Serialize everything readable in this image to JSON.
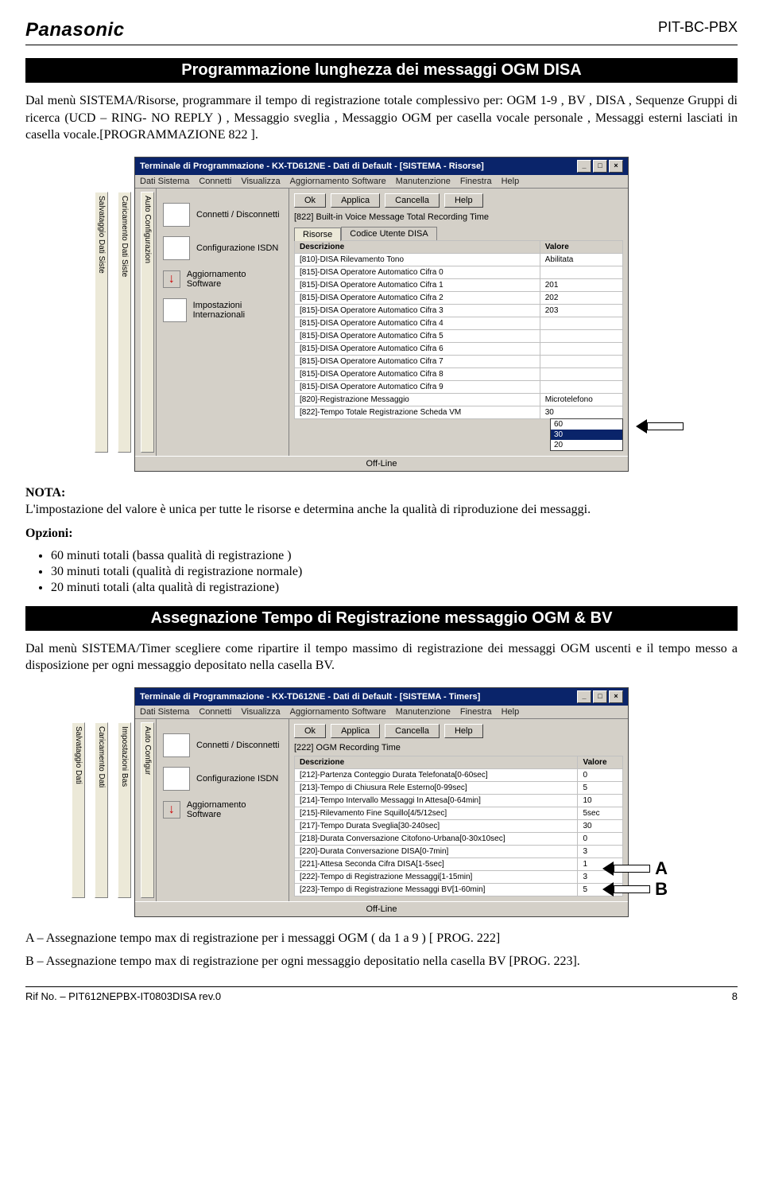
{
  "header": {
    "brand": "Panasonic",
    "code": "PIT-BC-PBX"
  },
  "section1": {
    "title": "Programmazione lunghezza dei messaggi OGM DISA",
    "intro": "Dal menù SISTEMA/Risorse, programmare il tempo di registrazione totale complessivo per: OGM 1-9 , BV , DISA , Sequenze Gruppi di ricerca (UCD – RING- NO REPLY ) , Messaggio sveglia , Messaggio OGM per casella vocale personale , Messaggi esterni lasciati in casella vocale.[PROGRAMMAZIONE 822 ].",
    "nota_label": "NOTA:",
    "nota_text": "L'impostazione del valore è unica per tutte le risorse e determina anche la qualità di riproduzione dei messaggi.",
    "opzioni_label": "Opzioni:",
    "opzioni": [
      "60 minuti totali (bassa qualità di registrazione )",
      "30 minuti totali (qualità di registrazione normale)",
      "20 minuti totali (alta qualità di registrazione)"
    ]
  },
  "section2": {
    "title": "Assegnazione Tempo di Registrazione messaggio OGM & BV",
    "intro": "Dal menù SISTEMA/Timer scegliere come ripartire il tempo massimo di registrazione dei messaggi OGM uscenti e il tempo messo a disposizione per ogni messaggio depositato nella casella BV.",
    "note_a": "A – Assegnazione tempo max di registrazione per i messaggi OGM  ( da 1 a 9 ) [ PROG. 222]",
    "note_b": "B – Assegnazione tempo max di registrazione per ogni messaggio depositatio nella casella BV [PROG. 223]."
  },
  "shot1": {
    "title": "Terminale di Programmazione - KX-TD612NE - Dati di Default - [SISTEMA - Risorse]",
    "menus": [
      "Dati Sistema",
      "Connetti",
      "Visualizza",
      "Aggiornamento Software",
      "Manutenzione",
      "Finestra",
      "Help"
    ],
    "vtabs": [
      "Auto Configurazion",
      "Caricamento Dati Siste",
      "Salvataggio Dati Siste"
    ],
    "sideitems": [
      "Connetti / Disconnetti",
      "Configurazione ISDN",
      "Aggiornamento Software",
      "Impostazioni Internazionali"
    ],
    "buttons": [
      "Ok",
      "Applica",
      "Cancella",
      "Help"
    ],
    "field_top": "[822] Built-in Voice Message Total Recording Time",
    "tabs": [
      "Risorse",
      "Codice Utente DISA"
    ],
    "cols": [
      "Descrizione",
      "Valore"
    ],
    "rows": [
      [
        "[810]-DISA Rilevamento Tono",
        "Abilitata"
      ],
      [
        "[815]-DISA Operatore Automatico Cifra 0",
        ""
      ],
      [
        "[815]-DISA Operatore Automatico Cifra 1",
        "201"
      ],
      [
        "[815]-DISA Operatore Automatico Cifra 2",
        "202"
      ],
      [
        "[815]-DISA Operatore Automatico Cifra 3",
        "203"
      ],
      [
        "[815]-DISA Operatore Automatico Cifra 4",
        ""
      ],
      [
        "[815]-DISA Operatore Automatico Cifra 5",
        ""
      ],
      [
        "[815]-DISA Operatore Automatico Cifra 6",
        ""
      ],
      [
        "[815]-DISA Operatore Automatico Cifra 7",
        ""
      ],
      [
        "[815]-DISA Operatore Automatico Cifra 8",
        ""
      ],
      [
        "[815]-DISA Operatore Automatico Cifra 9",
        ""
      ],
      [
        "[820]-Registrazione Messaggio",
        "Microtelefono"
      ],
      [
        "[822]-Tempo Totale Registrazione Scheda VM",
        "30"
      ]
    ],
    "dropdown": [
      "60",
      "30",
      "20"
    ],
    "status": "Off-Line"
  },
  "shot2": {
    "title": "Terminale di Programmazione - KX-TD612NE - Dati di Default - [SISTEMA - Timers]",
    "menus": [
      "Dati Sistema",
      "Connetti",
      "Visualizza",
      "Aggiornamento Software",
      "Manutenzione",
      "Finestra",
      "Help"
    ],
    "vtabs": [
      "Auto Configur",
      "Impostazioni Bas",
      "Caricamento Dati",
      "Salvataggio Dati"
    ],
    "sideitems": [
      "Connetti / Disconnetti",
      "Configurazione ISDN",
      "Aggiornamento Software"
    ],
    "buttons": [
      "Ok",
      "Applica",
      "Cancella",
      "Help"
    ],
    "field_top": "[222] OGM Recording Time",
    "cols": [
      "Descrizione",
      "Valore"
    ],
    "rows": [
      [
        "[212]-Partenza Conteggio Durata Telefonata[0-60sec]",
        "0"
      ],
      [
        "[213]-Tempo di Chiusura Rele Esterno[0-99sec]",
        "5"
      ],
      [
        "[214]-Tempo Intervallo Messaggi In Attesa[0-64min]",
        "10"
      ],
      [
        "[215]-Rilevamento Fine Squillo[4/5/12sec]",
        "5sec"
      ],
      [
        "[217]-Tempo Durata Sveglia[30-240sec]",
        "30"
      ],
      [
        "[218]-Durata Conversazione Citofono-Urbana[0-30x10sec]",
        "0"
      ],
      [
        "[220]-Durata Conversazione DISA[0-7min]",
        "3"
      ],
      [
        "[221]-Attesa Seconda Cifra DISA[1-5sec]",
        "1"
      ],
      [
        "[222]-Tempo di Registrazione Messaggi[1-15min]",
        "3"
      ],
      [
        "[223]-Tempo di Registrazione Messaggi BV[1-60min]",
        "5"
      ]
    ],
    "status": "Off-Line",
    "label_a": "A",
    "label_b": "B"
  },
  "footer": {
    "ref": "Rif No. – PIT612NEPBX-IT0803DISA rev.0",
    "page": "8"
  }
}
